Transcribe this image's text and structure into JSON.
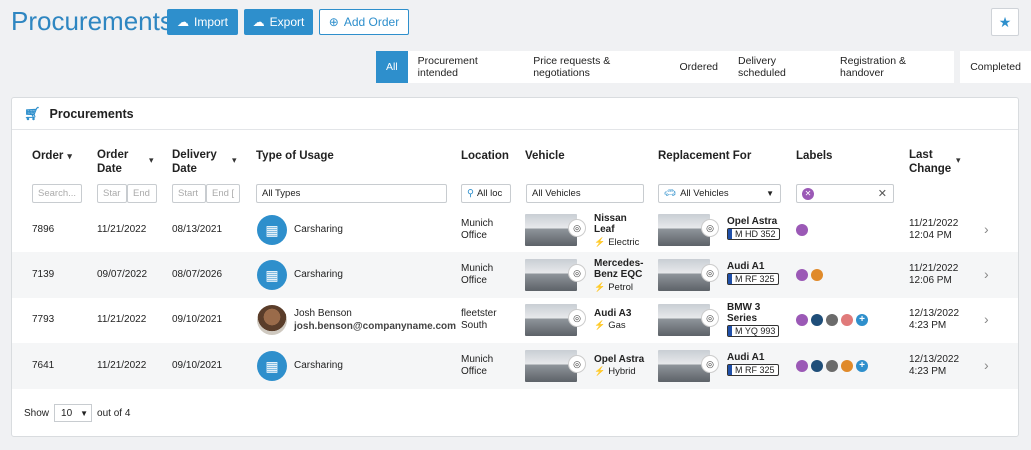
{
  "page": {
    "title": "Procurements"
  },
  "toolbar": {
    "import": "Import",
    "export": "Export",
    "add_order": "Add Order"
  },
  "tabs": [
    "All",
    "Procurement intended",
    "Price requests & negotiations",
    "Ordered",
    "Delivery scheduled",
    "Registration & handover",
    "Completed"
  ],
  "card": {
    "title": "Procurements"
  },
  "columns": {
    "order": "Order",
    "order_date_1": "Order",
    "order_date_2": "Date",
    "delivery_date_1": "Delivery",
    "delivery_date_2": "Date",
    "type_of_usage": "Type of Usage",
    "location": "Location",
    "vehicle": "Vehicle",
    "replacement_for": "Replacement For",
    "labels": "Labels",
    "last_change_1": "Last",
    "last_change_2": "Change"
  },
  "filters": {
    "search_placeholder": "Search...",
    "start": "Star",
    "end": "End",
    "start2": "Start",
    "end2": "End [",
    "types": "All Types",
    "location": "All loc",
    "vehicles": "All Vehicles",
    "rep_vehicles": "All Vehicles"
  },
  "colors": {
    "purple": "#9b59b6",
    "navy": "#1f4e79",
    "gray": "#6b6b6b",
    "pink": "#e07a7a",
    "orange": "#e08a2a",
    "blue": "#2e8fcc"
  },
  "rows": [
    {
      "order": "7896",
      "order_date": "11/21/2022",
      "delivery_date": "08/13/2021",
      "usage": "Carsharing",
      "usage_email": "",
      "location": [
        "Munich",
        "Office"
      ],
      "vehicle": [
        "Nissan",
        "Leaf"
      ],
      "fuel": "Electric",
      "rep_vehicle": [
        "Opel Astra"
      ],
      "plate": "M HD 352",
      "last_change": [
        "11/21/2022",
        "12:04 PM"
      ],
      "labels": [
        "purple"
      ]
    },
    {
      "order": "7139",
      "order_date": "09/07/2022",
      "delivery_date": "08/07/2026",
      "usage": "Carsharing",
      "usage_email": "",
      "location": [
        "Munich",
        "Office"
      ],
      "vehicle": [
        "Mercedes-",
        "Benz EQC"
      ],
      "fuel": "Petrol",
      "rep_vehicle": [
        "Audi A1"
      ],
      "plate": "M RF 325",
      "last_change": [
        "11/21/2022",
        "12:06 PM"
      ],
      "labels": [
        "purple",
        "orange"
      ]
    },
    {
      "order": "7793",
      "order_date": "11/21/2022",
      "delivery_date": "09/10/2021",
      "usage": "Josh Benson",
      "usage_email": "josh.benson@companyname.com",
      "location": [
        "fleetster",
        "South"
      ],
      "vehicle": [
        "Audi A3"
      ],
      "fuel": "Gas",
      "rep_vehicle": [
        "BMW 3",
        "Series"
      ],
      "plate": "M YQ 993",
      "last_change": [
        "12/13/2022",
        "4:23 PM"
      ],
      "labels": [
        "purple",
        "navy",
        "gray",
        "pink",
        "plus"
      ]
    },
    {
      "order": "7641",
      "order_date": "11/21/2022",
      "delivery_date": "09/10/2021",
      "usage": "Carsharing",
      "usage_email": "",
      "location": [
        "Munich",
        "Office"
      ],
      "vehicle": [
        "Opel Astra"
      ],
      "fuel": "Hybrid",
      "rep_vehicle": [
        "Audi A1"
      ],
      "plate": "M RF 325",
      "last_change": [
        "12/13/2022",
        "4:23 PM"
      ],
      "labels": [
        "purple",
        "navy",
        "gray",
        "orange",
        "plus"
      ]
    }
  ],
  "footer": {
    "show": "Show",
    "page_size": "10",
    "out_of": "out of 4"
  }
}
